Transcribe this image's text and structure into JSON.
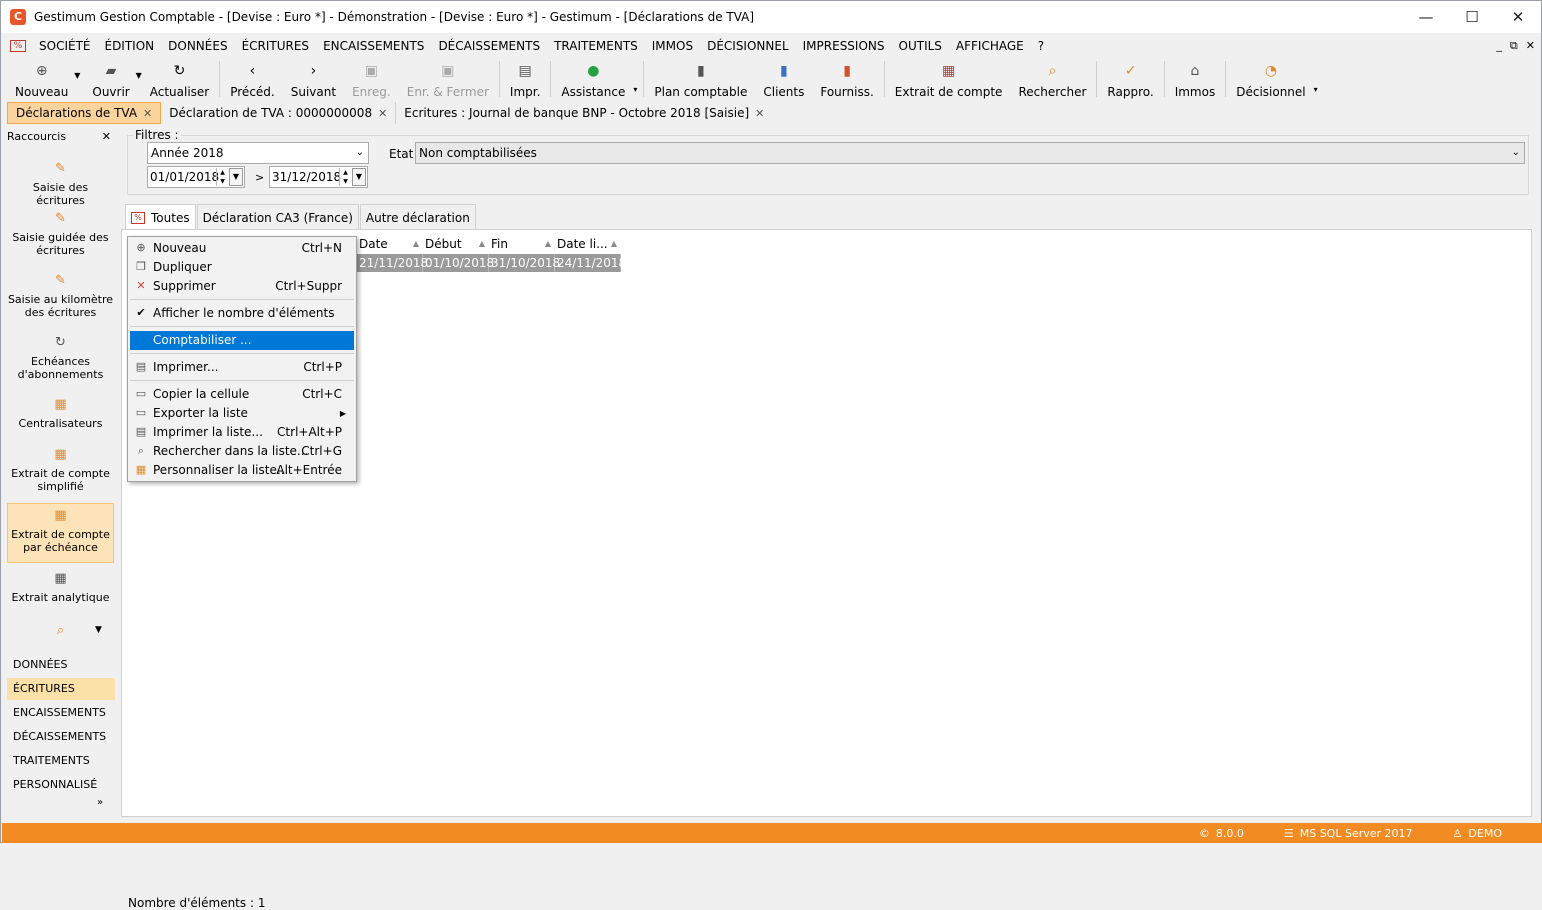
{
  "window": {
    "title": "Gestimum Gestion Comptable - [Devise : Euro *] - Démonstration - [Devise : Euro *] - Gestimum - [Déclarations de TVA]",
    "minimize": "—",
    "maximize": "☐",
    "close": "✕"
  },
  "menu": {
    "items": [
      "SOCIÉTÉ",
      "ÉDITION",
      "DONNÉES",
      "ÉCRITURES",
      "ENCAISSEMENTS",
      "DÉCAISSEMENTS",
      "TRAITEMENTS",
      "IMMOS",
      "DÉCISIONNEL",
      "IMPRESSIONS",
      "OUTILS",
      "AFFICHAGE",
      "?"
    ],
    "mdi_min": "_",
    "mdi_restore": "⧉",
    "mdi_close": "✕"
  },
  "toolbar": {
    "nouveau": "Nouveau",
    "ouvrir": "Ouvrir",
    "actualiser": "Actualiser",
    "preced": "Précéd.",
    "suivant": "Suivant",
    "enreg": "Enreg.",
    "enr_fermer": "Enr. & Fermer",
    "impr": "Impr.",
    "assistance": "Assistance",
    "plan": "Plan comptable",
    "clients": "Clients",
    "fourniss": "Fourniss.",
    "extrait": "Extrait de compte",
    "rechercher": "Rechercher",
    "rappro": "Rappro.",
    "immos": "Immos",
    "decisionnel": "Décisionnel"
  },
  "doc_tabs": [
    {
      "label": "Déclarations de TVA"
    },
    {
      "label": "Déclaration de TVA : 0000000008"
    },
    {
      "label": "Ecritures : Journal de banque BNP - Octobre 2018 [Saisie]"
    }
  ],
  "sidebar": {
    "title": "Raccourcis",
    "shortcuts": [
      "Saisie des écritures",
      "Saisie guidée des écritures",
      "Saisie au kilomètre des écritures",
      "Echéances d'abonnements",
      "Centralisateurs",
      "Extrait de compte simplifié",
      "Extrait de compte par échéance",
      "Extrait analytique"
    ],
    "categories": [
      "DONNÉES",
      "ÉCRITURES",
      "ENCAISSEMENTS",
      "DÉCAISSEMENTS",
      "TRAITEMENTS",
      "PERSONNALISÉ"
    ]
  },
  "filters": {
    "label": "Filtres :",
    "year": "Année 2018",
    "date_from": "01/01/2018",
    "to_sep": ">",
    "date_to": "31/12/2018",
    "etat_label": "Etat",
    "etat_value": "Non comptabilisées"
  },
  "tabs": [
    "Toutes",
    "Déclaration CA3 (France)",
    "Autre déclaration"
  ],
  "grid": {
    "columns": [
      "Date",
      "Début",
      "Fin",
      "Date li..."
    ],
    "rows": [
      [
        "21/11/2018",
        "01/10/2018",
        "31/10/2018",
        "24/11/2018"
      ]
    ]
  },
  "count": "Nombre d'éléments : 1",
  "context_menu": {
    "nouveau": {
      "label": "Nouveau",
      "shortcut": "Ctrl+N"
    },
    "dupliquer": {
      "label": "Dupliquer",
      "shortcut": ""
    },
    "supprimer": {
      "label": "Supprimer",
      "shortcut": "Ctrl+Suppr"
    },
    "afficher": {
      "label": "Afficher le nombre d'éléments",
      "shortcut": ""
    },
    "comptabiliser": {
      "label": "Comptabiliser ...",
      "shortcut": ""
    },
    "imprimer": {
      "label": "Imprimer...",
      "shortcut": "Ctrl+P"
    },
    "copier": {
      "label": "Copier la cellule",
      "shortcut": "Ctrl+C"
    },
    "exporter": {
      "label": "Exporter la liste",
      "shortcut": ""
    },
    "imprimer_liste": {
      "label": "Imprimer la liste...",
      "shortcut": "Ctrl+Alt+P"
    },
    "rechercher": {
      "label": "Rechercher dans la liste...",
      "shortcut": "Ctrl+G"
    },
    "personnaliser": {
      "label": "Personnaliser la liste...",
      "shortcut": "Alt+Entrée"
    }
  },
  "status": {
    "version": "8.0.0",
    "db": "MS SQL Server 2017",
    "user": "DEMO"
  },
  "colors": {
    "accent": "#f28c22",
    "highlight": "#0078d7",
    "tab_active": "#fbd39c"
  }
}
